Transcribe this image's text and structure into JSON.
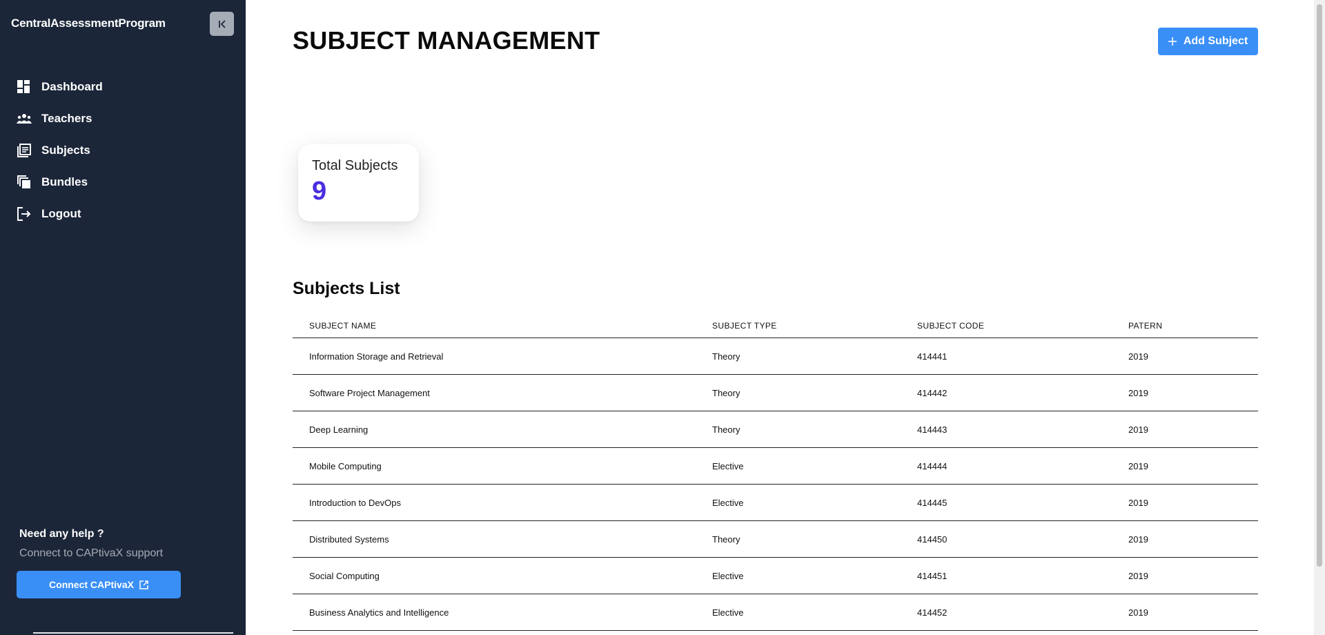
{
  "sidebar": {
    "brand": "CentralAssessmentProgram",
    "items": [
      {
        "label": "Dashboard",
        "icon": "dashboard-icon"
      },
      {
        "label": "Teachers",
        "icon": "teachers-icon"
      },
      {
        "label": "Subjects",
        "icon": "subjects-icon"
      },
      {
        "label": "Bundles",
        "icon": "bundles-icon"
      },
      {
        "label": "Logout",
        "icon": "logout-icon"
      }
    ],
    "help_title": "Need any help ?",
    "help_subtitle": "Connect to CAPtivaX support",
    "connect_label": "Connect CAPtivaX"
  },
  "header": {
    "title": "SUBJECT MANAGEMENT",
    "add_label": "Add Subject"
  },
  "stats": {
    "label": "Total Subjects",
    "value": "9"
  },
  "list": {
    "title": "Subjects List",
    "columns": [
      "SUBJECT NAME",
      "SUBJECT TYPE",
      "SUBJECT CODE",
      "PATERN"
    ],
    "rows": [
      [
        "Information Storage and Retrieval",
        "Theory",
        "414441",
        "2019"
      ],
      [
        "Software Project Management",
        "Theory",
        "414442",
        "2019"
      ],
      [
        "Deep Learning",
        "Theory",
        "414443",
        "2019"
      ],
      [
        "Mobile Computing",
        "Elective",
        "414444",
        "2019"
      ],
      [
        "Introduction to DevOps",
        "Elective",
        "414445",
        "2019"
      ],
      [
        "Distributed Systems",
        "Theory",
        "414450",
        "2019"
      ],
      [
        "Social Computing",
        "Elective",
        "414451",
        "2019"
      ],
      [
        "Business Analytics and Intelligence",
        "Elective",
        "414452",
        "2019"
      ]
    ]
  },
  "colors": {
    "sidebar_bg": "#1c2639",
    "accent": "#3a8ff7",
    "stat_value": "#4b2de0"
  }
}
